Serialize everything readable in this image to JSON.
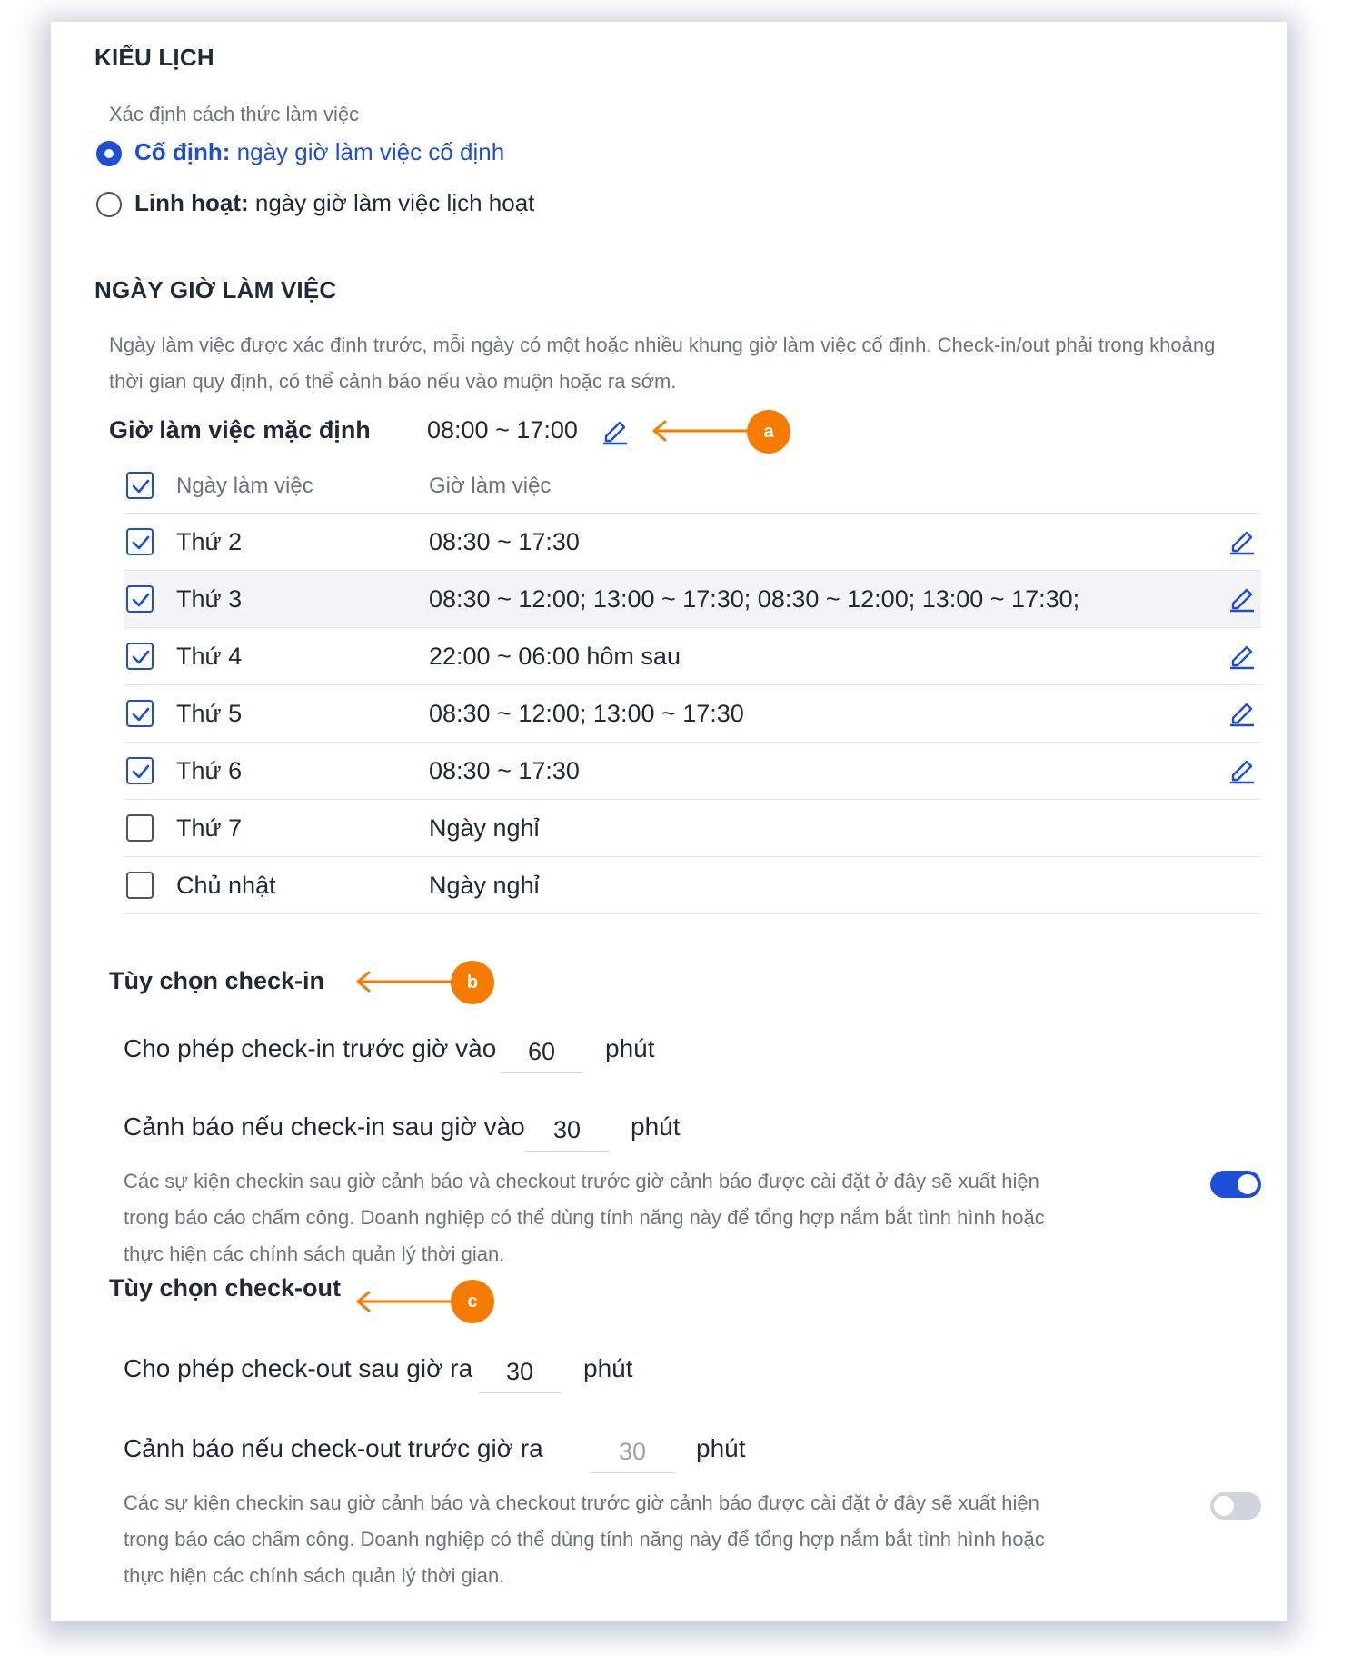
{
  "calendar_type": {
    "title": "KIỂU LỊCH",
    "description": "Xác định cách thức làm việc",
    "options": [
      {
        "label_bold": "Cố định:",
        "label_rest": " ngày giờ làm việc cố định",
        "selected": true
      },
      {
        "label_bold": "Linh hoạt:",
        "label_rest": " ngày giờ làm việc lịch hoạt",
        "selected": false
      }
    ]
  },
  "work_hours": {
    "title": "NGÀY GIỜ LÀM VIỆC",
    "description": "Ngày làm việc được xác định trước, mỗi ngày có một hoặc nhiều khung giờ làm việc cố định. Check-in/out phải trong khoảng thời gian quy định, có thể cảnh báo nếu vào muộn hoặc ra sớm.",
    "default_label": "Giờ làm việc mặc định",
    "default_time": "08:00 ~ 17:00",
    "table": {
      "headers": [
        "Ngày làm việc",
        "Giờ làm việc"
      ],
      "rows": [
        {
          "day": "Thứ 2",
          "hours": "08:30 ~ 17:30",
          "checked": true
        },
        {
          "day": "Thứ 3",
          "hours": "08:30 ~ 12:00; 13:00 ~ 17:30; 08:30 ~ 12:00; 13:00 ~ 17:30;",
          "checked": true
        },
        {
          "day": "Thứ 4",
          "hours": "22:00 ~ 06:00 hôm sau",
          "checked": true
        },
        {
          "day": "Thứ 5",
          "hours": "08:30 ~ 12:00; 13:00 ~ 17:30",
          "checked": true
        },
        {
          "day": "Thứ 6",
          "hours": "08:30 ~ 17:30",
          "checked": true
        },
        {
          "day": "Thứ 7",
          "hours": "Ngày nghỉ",
          "checked": false
        },
        {
          "day": "Chủ nhật",
          "hours": "Ngày nghỉ",
          "checked": false
        }
      ]
    }
  },
  "checkin": {
    "title": "Tùy chọn check-in",
    "allow_label": "Cho phép check-in trước giờ vào",
    "allow_value": "60",
    "warn_label": "Cảnh báo nếu check-in sau giờ vào",
    "warn_value": "30",
    "unit": "phút",
    "description": "Các sự kiện checkin sau giờ cảnh báo và checkout trước giờ cảnh báo được cài đặt ở đây sẽ xuất hiện trong báo cáo chấm công. Doanh nghiệp có thể dùng tính năng này để tổng hợp nắm bắt tình hình hoặc thực hiện các chính sách quản lý thời gian.",
    "toggle_on": true
  },
  "checkout": {
    "title": "Tùy chọn check-out",
    "allow_label": "Cho phép check-out sau giờ ra",
    "allow_value": "30",
    "warn_label": "Cảnh báo nếu check-out trước giờ ra",
    "warn_value": "30",
    "unit": "phút",
    "description": "Các sự kiện checkin sau giờ cảnh báo và checkout trước giờ cảnh báo được cài đặt ở đây sẽ xuất hiện trong báo cáo chấm công. Doanh nghiệp có thể dùng tính năng này để tổng hợp nắm bắt tình hình hoặc thực hiện các chính sách quản lý thời gian.",
    "toggle_on": false
  },
  "annotations": {
    "a": "a",
    "b": "b",
    "c": "c"
  },
  "colors": {
    "accent": "#1d4ed8",
    "annotation": "#f57c00"
  },
  "icons": [
    "pencil-edit-icon",
    "check-icon",
    "arrow-left-icon"
  ]
}
